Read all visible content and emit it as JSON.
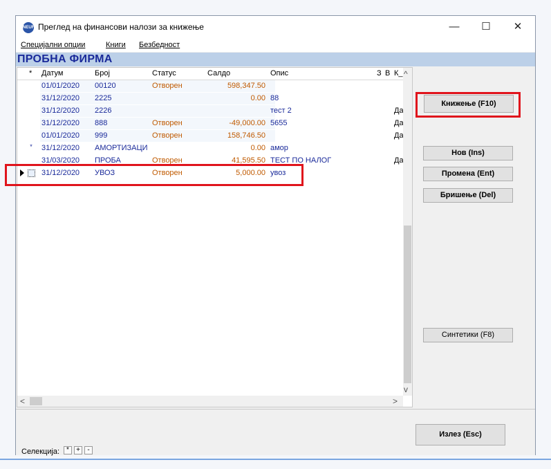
{
  "window": {
    "title": "Преглед на финансови налози за книжење",
    "app_icon_text": "NEUF",
    "minimize": "—",
    "maximize": "☐",
    "close": "✕"
  },
  "menu": [
    "Специјални опции",
    "Книги",
    "Безбедност"
  ],
  "company": "ПРОБНА ФИРМА",
  "grid": {
    "columns": {
      "marker": "*",
      "date": "Датум",
      "broj": "Број",
      "status": "Статус",
      "saldo": "Салдо",
      "opis": "Опис",
      "z": "З",
      "v": "В",
      "k": "К_"
    },
    "rows": [
      {
        "marker": "",
        "date": "01/01/2020",
        "broj": " 00120",
        "status": "Отворен",
        "saldo": "598,347.50",
        "opis": "",
        "k": ""
      },
      {
        "marker": "",
        "date": "31/12/2020",
        "broj": "2225",
        "status": "",
        "saldo": "0.00",
        "opis": "88",
        "k": ""
      },
      {
        "marker": "",
        "date": "31/12/2020",
        "broj": "2226",
        "status": "",
        "saldo": "",
        "opis": "тест 2",
        "k": "Да"
      },
      {
        "marker": "",
        "date": "31/12/2020",
        "broj": "888",
        "status": "Отворен",
        "saldo": "-49,000.00",
        "opis": "5655",
        "k": "Да"
      },
      {
        "marker": "",
        "date": "01/01/2020",
        "broj": "999",
        "status": "Отворен",
        "saldo": "158,746.50",
        "opis": "",
        "k": "Да"
      },
      {
        "marker": "*",
        "date": "31/12/2020",
        "broj": "АМОРТИЗАЦИ",
        "status": "",
        "saldo": "0.00",
        "opis": "амор",
        "k": ""
      },
      {
        "marker": "",
        "date": "31/03/2020",
        "broj": "ПРОБА",
        "status": "Отворен",
        "saldo": "41,595.50",
        "opis": "ТЕСТ ПО НАЛОГ",
        "k": "Да"
      },
      {
        "marker": "",
        "date": "31/12/2020",
        "broj": "УВОЗ",
        "status": "Отворен",
        "saldo": "5,000.00",
        "opis": "увоз",
        "k": ""
      }
    ]
  },
  "buttons": {
    "post": "Книжење (F10)",
    "new": "Нов (Ins)",
    "edit": "Промена (Ent)",
    "delete": "Бришење (Del)",
    "synthetics": "Синтетики (F8)",
    "exit": "Излез (Esc)"
  },
  "footer": {
    "selection_label": "Селекција:",
    "sel_all": "*",
    "sel_plus": "+",
    "sel_minus": "-"
  },
  "colors": {
    "company_bar": "#bcd0e8",
    "company_text": "#1a2a9a",
    "status_text": "#c05a00",
    "highlight": "#e0141c"
  }
}
